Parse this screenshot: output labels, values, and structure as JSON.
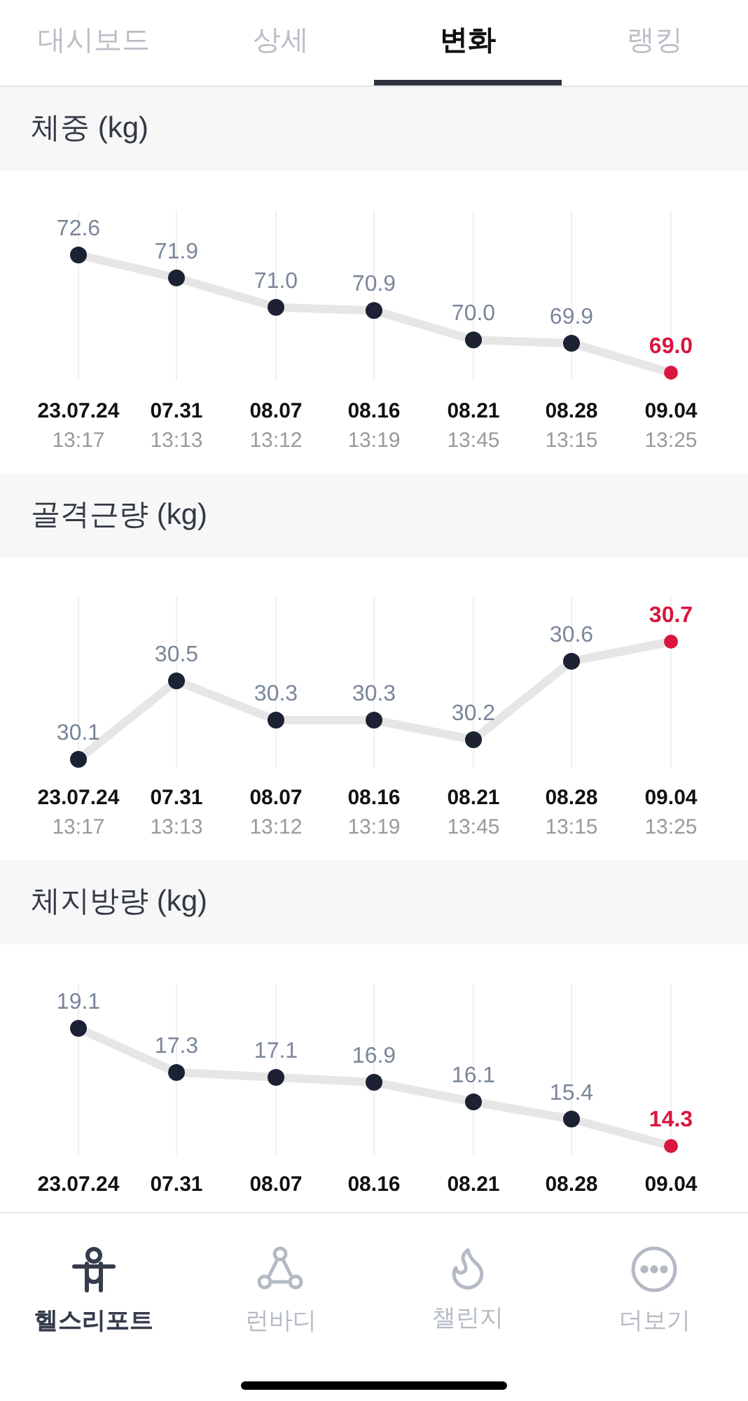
{
  "tabs": [
    {
      "label": "대시보드",
      "selected": false
    },
    {
      "label": "상세",
      "selected": false
    },
    {
      "label": "변화",
      "selected": true
    },
    {
      "label": "랭킹",
      "selected": false
    }
  ],
  "sections": [
    {
      "title": "체중 (kg)",
      "times": [
        "13:17",
        "13:13",
        "13:12",
        "13:19",
        "13:45",
        "13:15",
        "13:25"
      ],
      "chart_data": {
        "type": "line",
        "grid": true,
        "categories": [
          "23.07.24",
          "07.31",
          "08.07",
          "08.16",
          "08.21",
          "08.28",
          "09.04"
        ],
        "series": [
          {
            "color": "#e6e6e6",
            "marker": "circle",
            "values": [
              72.6,
              71.9,
              71.0,
              70.9,
              70.0,
              69.9,
              69.0
            ],
            "value_labels": [
              "72.6",
              "71.9",
              "71.0",
              "70.9",
              "70.0",
              "69.9",
              "69.0"
            ]
          }
        ]
      }
    },
    {
      "title": "골격근량 (kg)",
      "times": [
        "13:17",
        "13:13",
        "13:12",
        "13:19",
        "13:45",
        "13:15",
        "13:25"
      ],
      "chart_data": {
        "type": "line",
        "grid": true,
        "categories": [
          "23.07.24",
          "07.31",
          "08.07",
          "08.16",
          "08.21",
          "08.28",
          "09.04"
        ],
        "series": [
          {
            "color": "#e6e6e6",
            "marker": "circle",
            "values": [
              30.1,
              30.5,
              30.3,
              30.3,
              30.2,
              30.6,
              30.7
            ],
            "value_labels": [
              "30.1",
              "30.5",
              "30.3",
              "30.3",
              "30.2",
              "30.6",
              "30.7"
            ]
          }
        ]
      }
    },
    {
      "title": "체지방량 (kg)",
      "chart_data": {
        "type": "line",
        "grid": true,
        "categories": [
          "23.07.24",
          "07.31",
          "08.07",
          "08.16",
          "08.21",
          "08.28",
          "09.04"
        ],
        "series": [
          {
            "color": "#e6e6e6",
            "marker": "circle",
            "values": [
              19.1,
              17.3,
              17.1,
              16.9,
              16.1,
              15.4,
              14.3
            ],
            "value_labels": [
              "19.1",
              "17.3",
              "17.1",
              "16.9",
              "16.1",
              "15.4",
              "14.3"
            ]
          }
        ]
      }
    }
  ],
  "nav": [
    {
      "kind": "person",
      "label": "헬스리포트",
      "selected": true
    },
    {
      "kind": "nodes",
      "label": "런바디",
      "selected": false
    },
    {
      "kind": "flame",
      "label": "챌린지",
      "selected": false
    },
    {
      "kind": "more",
      "label": "더보기",
      "selected": false
    }
  ]
}
